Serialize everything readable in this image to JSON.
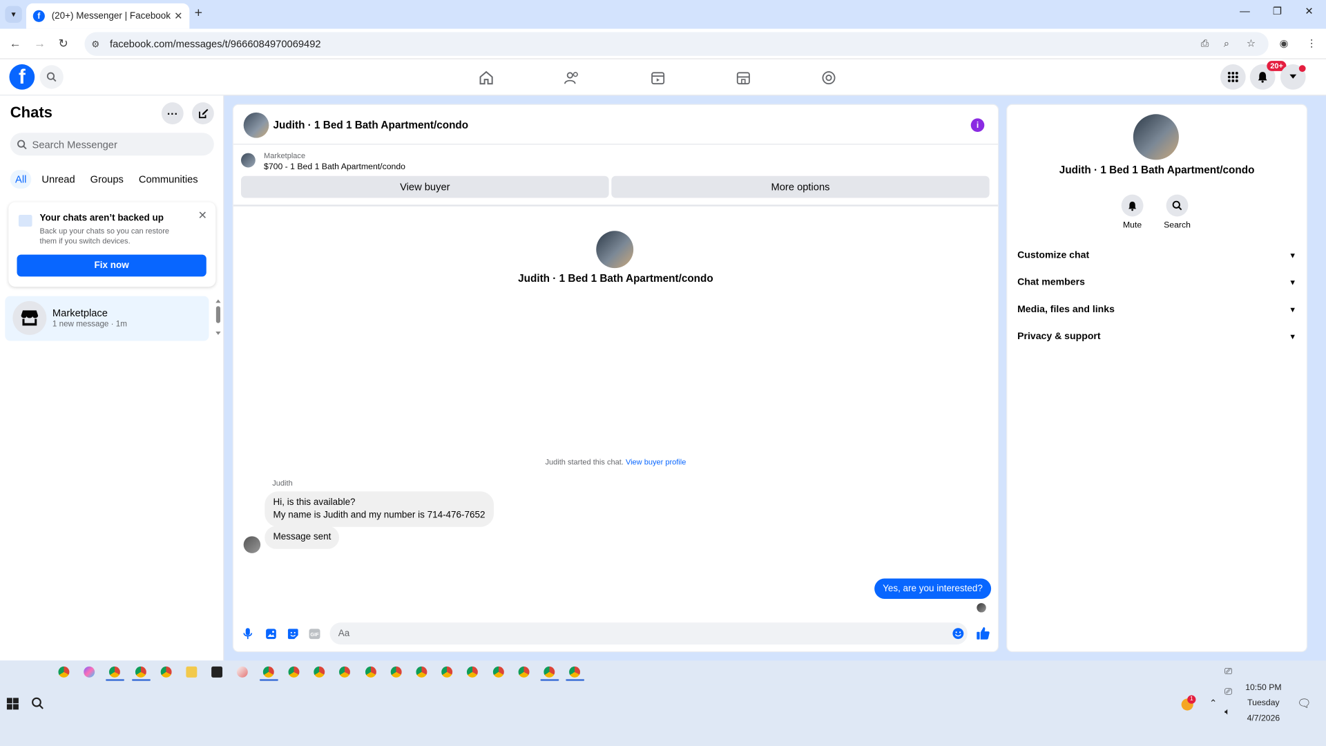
{
  "browser": {
    "tab_title": "(20+) Messenger | Facebook",
    "url": "facebook.com/messages/t/9666084970069492"
  },
  "fbnav": {
    "notifications_badge": "20+"
  },
  "sidebar": {
    "title": "Chats",
    "search_placeholder": "Search Messenger",
    "filters": [
      "All",
      "Unread",
      "Groups",
      "Communities"
    ],
    "backup": {
      "title": "Your chats aren’t backed up",
      "description": "Back up your chats so you can restore them if you switch devices.",
      "button": "Fix now"
    },
    "chats": [
      {
        "name": "Marketplace",
        "subtitle": "1 new message · 1m"
      }
    ]
  },
  "conversation": {
    "title": "Judith · 1 Bed 1 Bath Apartment/condo",
    "marketplace_label": "Marketplace",
    "listing": "$700 - 1 Bed 1 Bath Apartment/condo",
    "view_buyer": "View buyer",
    "more_options": "More options",
    "intro_name": "Judith · 1 Bed 1 Bath Apartment/condo",
    "started_text": "Judith started this chat.",
    "view_buyer_profile": "View buyer profile",
    "sender": "Judith",
    "messages_in": [
      "Hi, is this available?",
      "My name is Judith and my number is 714-476-7652",
      "Message sent"
    ],
    "message_out": "Yes, are you interested?",
    "composer_placeholder": "Aa",
    "gif_label": "GIF"
  },
  "info_panel": {
    "name": "Judith · 1 Bed 1 Bath Apartment/condo",
    "actions": [
      "Mute",
      "Search"
    ],
    "sections": [
      "Customize chat",
      "Chat members",
      "Media, files and links",
      "Privacy & support"
    ]
  },
  "taskbar": {
    "time": "10:50 PM",
    "day": "Tuesday",
    "date": "4/7/2026",
    "tray_badge": "1"
  },
  "colors": {
    "facebook_blue": "#0866ff",
    "info_purple": "#8a2be2",
    "badge_red": "#e41e3f"
  }
}
